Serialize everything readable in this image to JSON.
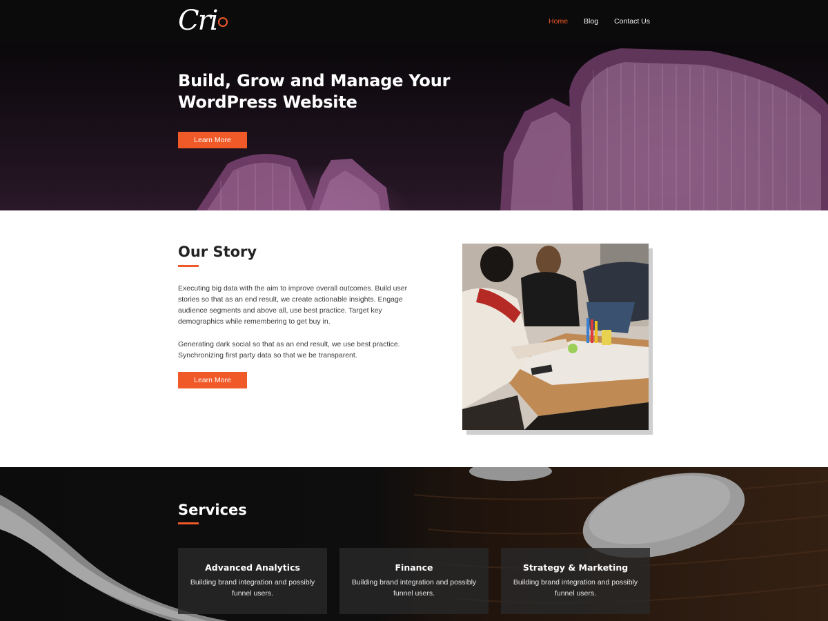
{
  "header": {
    "logo_text": "Cri",
    "nav": [
      {
        "label": "Home",
        "active": true
      },
      {
        "label": "Blog",
        "active": false
      },
      {
        "label": "Contact Us",
        "active": false
      }
    ]
  },
  "hero": {
    "title": "Build, Grow and Manage Your WordPress Website",
    "button": "Learn More"
  },
  "story": {
    "title": "Our Story",
    "paragraph1": "Executing big data with the aim to improve overall outcomes. Build user stories so that as an end result, we create actionable insights. Engage audience segments and above all, use best practice. Target key demographics while remembering to get buy in.",
    "paragraph2": "Generating dark social so that as an end result, we use best practice. Synchronizing first party data so that we be transparent.",
    "button": "Learn More"
  },
  "services": {
    "title": "Services",
    "cards": [
      {
        "title": "Advanced Analytics",
        "description": "Building brand integration and possibly funnel users."
      },
      {
        "title": "Finance",
        "description": "Building brand integration and possibly funnel users."
      },
      {
        "title": "Strategy & Marketing",
        "description": "Building brand integration and possibly funnel users."
      }
    ]
  },
  "colors": {
    "accent": "#f05a28",
    "header_bg": "#0b0b0b",
    "hero_tint": "#96508c"
  },
  "icons": [
    "logo-mark",
    "skyscraper-image",
    "team-meeting-photo",
    "desk-mouse-image"
  ]
}
